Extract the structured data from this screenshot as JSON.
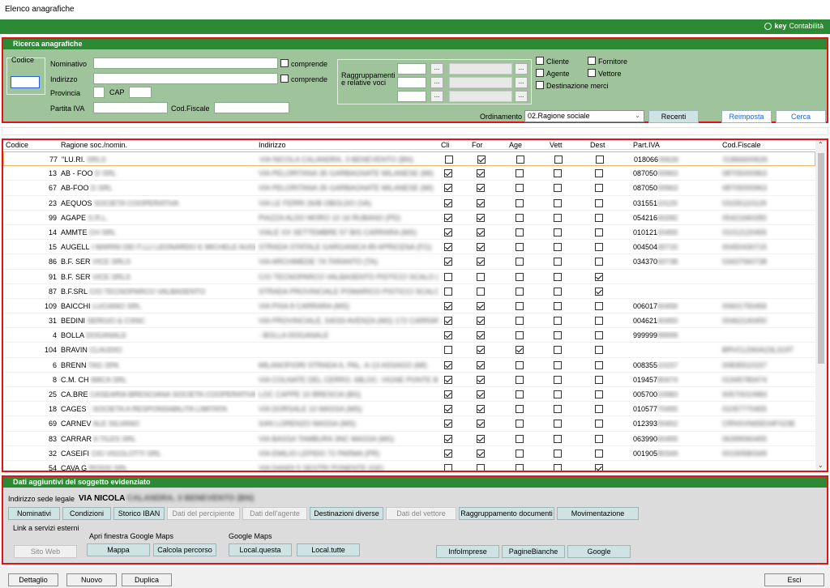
{
  "window": {
    "title": "Elenco anagrafiche"
  },
  "brand": {
    "prefix": "key",
    "suffix": "Contabilità"
  },
  "search": {
    "title": "Ricerca anagrafiche",
    "labels": {
      "codice": "Codice",
      "nominativo": "Nominativo",
      "indirizzo": "Indirizzo",
      "provincia": "Provincia",
      "cap": "CAP",
      "partita_iva": "Partita IVA",
      "cod_fiscale": "Cod.Fiscale",
      "comprende": "comprende",
      "raggruppamenti_1": "Raggruppamenti",
      "raggruppamenti_2": "e relative voci",
      "ordinamento": "Ordinamento"
    },
    "checkboxes": {
      "cliente": "Cliente",
      "agente": "Agente",
      "fornitore": "Fornitore",
      "vettore": "Vettore",
      "destinazione": "Destinazione merci"
    },
    "dots": "...",
    "ordinamento_value": "02.Ragione sociale",
    "buttons": {
      "recenti": "Recenti",
      "reimposta": "Reimposta",
      "cerca": "Cerca"
    }
  },
  "grid": {
    "columns": [
      "Codice",
      "Ragione soc./nomin.",
      "Indirizzo",
      "Cli",
      "For",
      "Age",
      "Vett",
      "Dest",
      "Part.IVA",
      "Cod.Fiscale"
    ],
    "rows": [
      {
        "code": "77",
        "name": "\"LU.RI.",
        "name_blur": "SRLS",
        "addr": "VIA NICOLA CALANDRA, 3 BENEVENTO (BN)",
        "cli": false,
        "for": true,
        "age": false,
        "vett": false,
        "dest": false,
        "piva": "018066",
        "piva_blur": "00626",
        "cf": "01866600626"
      },
      {
        "code": "13",
        "name": "AB - FOO",
        "name_blur": "D SRL",
        "addr": "VIA PELORITANA 35 GARBAGNATE MILANESE (MI)",
        "cli": true,
        "for": true,
        "age": false,
        "vett": false,
        "dest": false,
        "piva": "087050",
        "piva_blur": "00963",
        "cf": "08705000963"
      },
      {
        "code": "67",
        "name": "AB-FOO",
        "name_blur": "D SRL",
        "addr": "VIA PELORITANA 35 GARBAGNATE MILANESE (MI)",
        "cli": true,
        "for": true,
        "age": false,
        "vett": false,
        "dest": false,
        "piva": "087050",
        "piva_blur": "00963",
        "cf": "08705000963"
      },
      {
        "code": "23",
        "name": "AEQUOS",
        "name_blur": "SOCIETA COOPERATIVA",
        "addr": "VIA LE FERRI 26/B OBOLDO (VA)",
        "cli": true,
        "for": true,
        "age": false,
        "vett": false,
        "dest": false,
        "piva": "031551",
        "piva_blur": "10129",
        "cf": "03155110129"
      },
      {
        "code": "99",
        "name": "AGAPE",
        "name_blur": "S.R.L.",
        "addr": "PIAZZA ALDO MORO 10 16 RUBANO (PD)",
        "cli": true,
        "for": true,
        "age": false,
        "vett": false,
        "dest": false,
        "piva": "054216",
        "piva_blur": "60282",
        "cf": "05421660282"
      },
      {
        "code": "14",
        "name": "AMMTE",
        "name_blur": "CH SRL",
        "addr": "VIALE XX SETTEMBRE 57 BIS CARRARA (MS)",
        "cli": true,
        "for": true,
        "age": false,
        "vett": false,
        "dest": false,
        "piva": "010121",
        "piva_blur": "20455",
        "cf": "01012120455"
      },
      {
        "code": "15",
        "name": "AUGELL",
        "name_blur": "I MARINI DEI F.LLI LEONARDO E MICHELE AUGELL",
        "addr": "STRADA STATALE GARGANICA 89 APRICENA (FG)",
        "cli": true,
        "for": true,
        "age": false,
        "vett": false,
        "dest": false,
        "piva": "004504",
        "piva_blur": "30715",
        "cf": "00450430715"
      },
      {
        "code": "86",
        "name": "B.F. SER",
        "name_blur": "VICE SRLS",
        "addr": "VIA ARCHIMEDE 7A TARANTO (TA)",
        "cli": true,
        "for": true,
        "age": false,
        "vett": false,
        "dest": false,
        "piva": "034370",
        "piva_blur": "60738",
        "cf": "03437060738"
      },
      {
        "code": "91",
        "name": "B.F. SER",
        "name_blur": "VICE SRLS",
        "addr": "C/O TECNOPARCO VALBASENTO PISTICCI SCALO (MT)",
        "cli": false,
        "for": false,
        "age": false,
        "vett": false,
        "dest": true,
        "piva": "",
        "piva_blur": "",
        "cf": ""
      },
      {
        "code": "87",
        "name": "B.F.SRL",
        "name_blur": "C/O TECNOPARCO VALBASENTO",
        "addr": "STRADA PROVINCIALE POMARICO PISTICCI SCALO (MT)",
        "cli": false,
        "for": false,
        "age": false,
        "vett": false,
        "dest": true,
        "piva": "",
        "piva_blur": "",
        "cf": ""
      },
      {
        "code": "109",
        "name": "BAICCHI",
        "name_blur": "LUCIANO SRL",
        "addr": "VIA PISA 8 CARRARA (MS)",
        "cli": true,
        "for": true,
        "age": false,
        "vett": false,
        "dest": false,
        "piva": "006017",
        "piva_blur": "50456",
        "cf": "00601750456"
      },
      {
        "code": "31",
        "name": "BEDINI",
        "name_blur": "SERGIO & CSNC",
        "addr": "VIA PROVINCIALE, 54033 AVENZA (MS) 172 CARRARA",
        "cli": true,
        "for": true,
        "age": false,
        "vett": false,
        "dest": false,
        "piva": "004621",
        "piva_blur": "40450",
        "cf": "00462140450"
      },
      {
        "code": "4",
        "name": "BOLLA",
        "name_blur": "DOGANALE",
        "addr": "- BOLLA DOGANALE",
        "cli": true,
        "for": true,
        "age": false,
        "vett": false,
        "dest": false,
        "piva": "999999",
        "piva_blur": "99999",
        "cf": ""
      },
      {
        "code": "104",
        "name": "BRAVIN",
        "name_blur": "CLAUDIO",
        "addr": "",
        "cli": false,
        "for": true,
        "age": true,
        "vett": false,
        "dest": false,
        "piva": "",
        "piva_blur": "",
        "cf": "BRVCLD60A23L319T"
      },
      {
        "code": "6",
        "name": "BRENN",
        "name_blur": "TAG SPA",
        "addr": "MILANOFIORI STRADA 6, PAL. A-13 ASSAGO (MI)",
        "cli": true,
        "for": true,
        "age": false,
        "vett": false,
        "dest": false,
        "piva": "008355",
        "piva_blur": "10157",
        "cf": "00835510157"
      },
      {
        "code": "8",
        "name": "C.M. CH",
        "name_blur": "IMICA SRL",
        "addr": "VIA COLNATE DEL CERRO, 68LOC. VIGNE PONTE BUGGIANESE",
        "cli": true,
        "for": true,
        "age": false,
        "vett": false,
        "dest": false,
        "piva": "019457",
        "piva_blur": "80474",
        "cf": "01945780474"
      },
      {
        "code": "25",
        "name": "CA.BRE",
        "name_blur": "CASEARIA BRESCIANA SOCIETA COOPERATIVA A",
        "addr": "LOC CAPPE 10 BRESCIA (BS)",
        "cli": true,
        "for": true,
        "age": false,
        "vett": false,
        "dest": false,
        "piva": "005700",
        "piva_blur": "10983",
        "cf": "00570010983"
      },
      {
        "code": "18",
        "name": "CAGES",
        "name_blur": "- SOCIETA A RESPONSABILITA LIMITATA",
        "addr": "VIA DORSALE 10 MASSA (MS)",
        "cli": true,
        "for": true,
        "age": false,
        "vett": false,
        "dest": false,
        "piva": "010577",
        "piva_blur": "70455",
        "cf": "01057770455"
      },
      {
        "code": "69",
        "name": "CARNEV",
        "name_blur": "ALE SILVANO",
        "addr": "SAN LORENZO MASSA (MS)",
        "cli": true,
        "for": true,
        "age": false,
        "vett": false,
        "dest": false,
        "piva": "012393",
        "piva_blur": "00452",
        "cf": "CRNSVN65E04F023E"
      },
      {
        "code": "83",
        "name": "CARRAR",
        "name_blur": "A TILES SRL",
        "addr": "VIA BASSA TAMBURA 3NC MASSA (MS)",
        "cli": true,
        "for": true,
        "age": false,
        "vett": false,
        "dest": false,
        "piva": "063990",
        "piva_blur": "60455",
        "cf": "06399060455"
      },
      {
        "code": "32",
        "name": "CASEIFI",
        "name_blur": "CIO VIGOLOTTI SRL",
        "addr": "VIA EMILIO LEPIDO 72 PARMA (PR)",
        "cli": true,
        "for": true,
        "age": false,
        "vett": false,
        "dest": false,
        "piva": "001905",
        "piva_blur": "80349",
        "cf": "00190580349"
      },
      {
        "code": "54",
        "name": "CAVA G",
        "name_blur": "ROSSI SRL",
        "addr": "VIA DANDI 5 SESTRI PONENTE (GE)",
        "cli": false,
        "for": false,
        "age": false,
        "vett": false,
        "dest": true,
        "piva": "",
        "piva_blur": "",
        "cf": ""
      }
    ]
  },
  "details": {
    "title": "Dati aggiuntivi del soggetto evidenziato",
    "address_label": "Indirizzo sede legale",
    "address_value": "VIA NICOLA",
    "address_blur": "CALANDRA, 3 BENEVENTO (BN)",
    "tabs": [
      "Nominativi",
      "Condizioni",
      "Storico IBAN",
      "Dati del percipiente",
      "Dati dell'agente",
      "Destinazioni diverse",
      "Dati del vettore",
      "Raggruppamento documenti",
      "Movimentazione"
    ],
    "link_label": "Link a servizi esterni",
    "maps_window_label": "Apri finestra Google Maps",
    "maps_label": "Google Maps",
    "links": {
      "sito_web": "Sito Web",
      "mappa": "Mappa",
      "calcola": "Calcola percorso",
      "local_questa": "Local.questa",
      "local_tutte": "Local.tutte",
      "infoimprese": "InfoImprese",
      "paginebianche": "PagineBianche",
      "google": "Google"
    }
  },
  "footer": {
    "dettaglio": "Dettaglio",
    "nuovo": "Nuovo",
    "duplica": "Duplica",
    "esci": "Esci"
  }
}
